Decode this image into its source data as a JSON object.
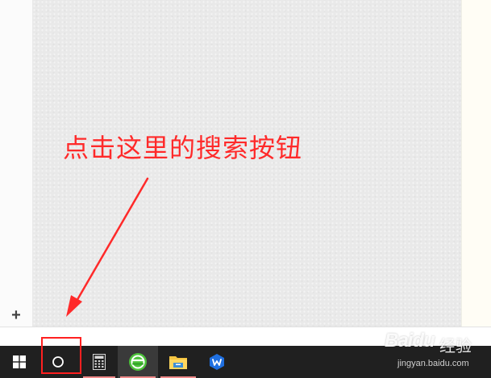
{
  "annotation": {
    "text": "点击这里的搜索按钮",
    "color": "#ff2a2a"
  },
  "left_panel": {
    "add_label": "+"
  },
  "taskbar": {
    "background": "#202020",
    "items": [
      {
        "name": "start",
        "icon": "windows-logo-icon"
      },
      {
        "name": "search",
        "icon": "cortana-search-icon"
      },
      {
        "name": "calculator",
        "icon": "calculator-icon"
      },
      {
        "name": "360-browser",
        "icon": "360-browser-icon"
      },
      {
        "name": "file-explorer",
        "icon": "file-explorer-icon"
      },
      {
        "name": "wps",
        "icon": "wps-office-icon"
      }
    ]
  },
  "watermark": {
    "logo": "Baidu",
    "suffix": "经验",
    "url": "jingyan.baidu.com"
  }
}
